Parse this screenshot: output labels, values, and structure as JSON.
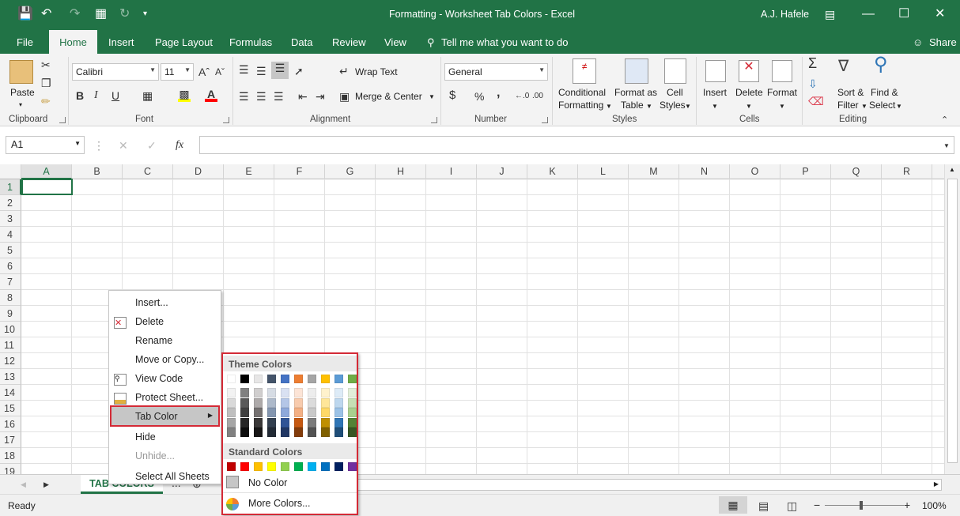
{
  "window": {
    "title": "Formatting - Worksheet Tab Colors  -  Excel",
    "user": "A.J. Hafele"
  },
  "tabs": [
    "File",
    "Home",
    "Insert",
    "Page Layout",
    "Formulas",
    "Data",
    "Review",
    "View"
  ],
  "tell_me": "Tell me what you want to do",
  "share": "Share",
  "ribbon": {
    "clipboard": {
      "label": "Clipboard",
      "paste": "Paste"
    },
    "font": {
      "label": "Font",
      "name": "Calibri",
      "size": "11",
      "bold": "B",
      "italic": "I",
      "underline": "U"
    },
    "alignment": {
      "label": "Alignment",
      "wrap": "Wrap Text",
      "merge": "Merge & Center"
    },
    "number": {
      "label": "Number",
      "format": "General",
      "currency": "$",
      "percent": "%",
      "comma": ","
    },
    "styles": {
      "label": "Styles",
      "conditional": [
        "Conditional",
        "Formatting"
      ],
      "format_table": [
        "Format as",
        "Table"
      ],
      "cell_styles": [
        "Cell",
        "Styles"
      ]
    },
    "cells": {
      "label": "Cells",
      "insert": "Insert",
      "delete": "Delete",
      "format": "Format"
    },
    "editing": {
      "label": "Editing",
      "sort": [
        "Sort &",
        "Filter"
      ],
      "find": [
        "Find &",
        "Select"
      ]
    }
  },
  "formula_bar": {
    "name_box": "A1",
    "fx": "fx",
    "value": ""
  },
  "columns": [
    "A",
    "B",
    "C",
    "D",
    "E",
    "F",
    "G",
    "H",
    "I",
    "J",
    "K",
    "L",
    "M",
    "N",
    "O",
    "P",
    "Q",
    "R"
  ],
  "rows": [
    "1",
    "2",
    "3",
    "4",
    "5",
    "6",
    "7",
    "8",
    "9",
    "10",
    "11",
    "12",
    "13",
    "14",
    "15",
    "16",
    "17",
    "18",
    "19"
  ],
  "sheet_tab": "TAB COLORS",
  "sheet_more": "...",
  "status": {
    "ready": "Ready",
    "zoom": "100%",
    "minus": "−",
    "plus": "+"
  },
  "context_menu": {
    "items": [
      {
        "label": "Insert...",
        "icon": ""
      },
      {
        "label": "Delete",
        "icon": "delete-sheet-icon"
      },
      {
        "label": "Rename",
        "icon": ""
      },
      {
        "label": "Move or Copy...",
        "icon": ""
      },
      {
        "label": "View Code",
        "icon": "view-code-icon"
      },
      {
        "label": "Protect Sheet...",
        "icon": "protect-sheet-icon"
      },
      {
        "label": "Tab Color",
        "icon": "",
        "submenu": true,
        "highlighted": true
      },
      {
        "label": "Hide",
        "icon": ""
      },
      {
        "label": "Unhide...",
        "icon": "",
        "disabled": true
      },
      {
        "label": "Select All Sheets",
        "icon": ""
      }
    ]
  },
  "palette": {
    "theme_header": "Theme Colors",
    "standard_header": "Standard Colors",
    "no_color": "No Color",
    "more_colors": "More Colors...",
    "theme_top": [
      "#FFFFFF",
      "#000000",
      "#E7E6E6",
      "#44546A",
      "#4472C4",
      "#ED7D31",
      "#A5A5A5",
      "#FFC000",
      "#5B9BD5",
      "#70AD47"
    ],
    "theme_shades": [
      [
        "#F2F2F2",
        "#D9D9D9",
        "#BFBFBF",
        "#A6A6A6",
        "#808080"
      ],
      [
        "#808080",
        "#595959",
        "#404040",
        "#262626",
        "#0D0D0D"
      ],
      [
        "#D0CECE",
        "#AEAAAA",
        "#757171",
        "#3A3838",
        "#171616"
      ],
      [
        "#D6DCE4",
        "#ADB9CA",
        "#8496B0",
        "#333F4F",
        "#222A35"
      ],
      [
        "#D9E1F2",
        "#B4C6E7",
        "#8EA9DB",
        "#305496",
        "#203764"
      ],
      [
        "#FCE4D6",
        "#F8CBAD",
        "#F4B084",
        "#C65911",
        "#833C0B"
      ],
      [
        "#EDEDED",
        "#DBDBDB",
        "#C9C9C9",
        "#7B7B7B",
        "#525252"
      ],
      [
        "#FFF2CC",
        "#FFE699",
        "#FFD966",
        "#BF8F00",
        "#806000"
      ],
      [
        "#DDEBF7",
        "#BDD7EE",
        "#9BC2E6",
        "#2F75B5",
        "#1F4E78"
      ],
      [
        "#E2EFDA",
        "#C6E0B4",
        "#A9D08E",
        "#548235",
        "#375623"
      ]
    ],
    "standard": [
      "#C00000",
      "#FF0000",
      "#FFC000",
      "#FFFF00",
      "#92D050",
      "#00B050",
      "#00B0F0",
      "#0070C0",
      "#002060",
      "#7030A0"
    ]
  }
}
